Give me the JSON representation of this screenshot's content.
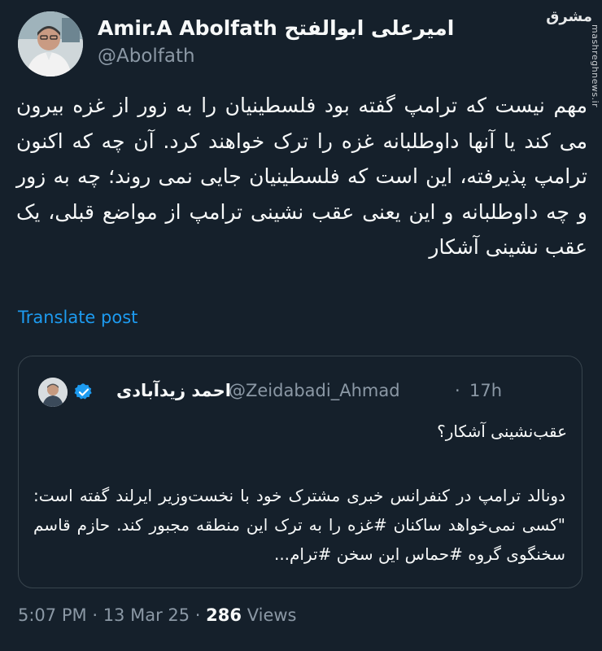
{
  "author": {
    "name": "Amir.A Abolfath امیرعلی ابوالفتح",
    "handle": "@Abolfath"
  },
  "watermark": {
    "logo": "مشرق",
    "url": "mashreghnews.ir"
  },
  "tweet": {
    "text": "مهم نیست که ترامپ گفته بود فلسطینیان را به زور از غزه بیرون می کند یا آنها داوطلبانه غزه را ترک خواهند کرد. آن چه که اکنون ترامپ پذیرفته، این است که فلسطینیان جایی نمی روند؛ چه به زور و چه داوطلبانه و این یعنی عقب نشینی ترامپ از مواضع قبلی، یک عقب نشینی آشکار",
    "translate_label": "Translate post"
  },
  "quote": {
    "name": "احمد زیدآبادی",
    "handle": "@Zeidabadi_Ahmad",
    "separator": "·",
    "time": "17h",
    "title": "عقب‌نشینی آشکار؟",
    "body": "دونالد ترامپ در کنفرانس خبری مشترک خود با نخست‌وزیر ایرلند گفته است: \"کسی نمی‌خواهد ساکنان #غزه را به ترک این منطقه مجبور کند. حازم قاسم سخنگوی گروه #حماس این سخن #ترام..."
  },
  "footer": {
    "time": "5:07 PM",
    "sep1": "·",
    "date": "13 Mar 25",
    "sep2": "·",
    "views_count": "286",
    "views_label": "Views"
  },
  "colors": {
    "background": "#15202b",
    "text": "#f7f9f9",
    "muted": "#8b98a5",
    "link": "#1d9bf0",
    "border": "#38444d",
    "verified": "#1d9bf0"
  }
}
